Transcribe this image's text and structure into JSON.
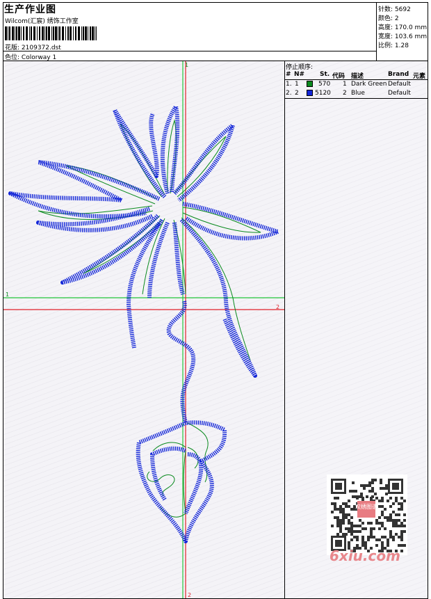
{
  "header": {
    "title": "生产作业图",
    "company": "Wilcom(汇宸) 绣饰工作室",
    "design_label": "花版:",
    "design_file": "2109372.dst",
    "color_label": "色位:",
    "colorway": "Colorway 1"
  },
  "stats": [
    {
      "label": "针数:",
      "value": "5692"
    },
    {
      "label": "颜色:",
      "value": "2"
    },
    {
      "label": "高度:",
      "value": "170.0 mm"
    },
    {
      "label": "宽度:",
      "value": "103.6 mm"
    },
    {
      "label": "比例:",
      "value": "1.28"
    }
  ],
  "stop_sequence": {
    "title": "停止顺序:",
    "columns": [
      "#",
      "N#",
      "St.",
      "代码",
      "描述",
      "Brand",
      "元素"
    ],
    "rows": [
      {
        "index": "1.",
        "n": "1",
        "stitches": "570",
        "code": "1",
        "description": "Dark Green",
        "brand": "Default",
        "color": "#0a8a1e"
      },
      {
        "index": "2.",
        "n": "2",
        "stitches": "5120",
        "code": "2",
        "description": "Blue",
        "brand": "Default",
        "color": "#1326d8"
      }
    ]
  },
  "canvas": {
    "markers": {
      "green_top": "1",
      "green_left": "1",
      "red_right": "2",
      "red_bottom": "2"
    },
    "thread_colors": {
      "green": "#0a8a1e",
      "blue": "#1326d8"
    },
    "guide_colors": {
      "green": "#22c43a",
      "red": "#e0202a"
    }
  },
  "watermark": {
    "text": "6xiu.com",
    "qr_badge": "汉绣图谱"
  }
}
